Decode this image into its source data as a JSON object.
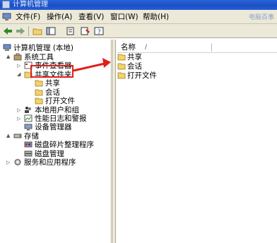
{
  "window": {
    "title": "计算机管理"
  },
  "menu": [
    {
      "label": "文件(F)"
    },
    {
      "label": "操作(A)"
    },
    {
      "label": "查看(V)"
    },
    {
      "label": "窗口(W)"
    },
    {
      "label": "帮助(H)"
    }
  ],
  "logo_text": "电脑百事",
  "toolbar": [
    "back-icon",
    "forward-icon",
    "up-folder-icon",
    "console-tree-icon",
    "export-icon",
    "properties-icon",
    "help-icon"
  ],
  "tree": {
    "root": "计算机管理 (本地)",
    "system_tools": "系统工具",
    "event_viewer": "事件查看器",
    "shared_folders": "共享文件夹",
    "shares": "共享",
    "sessions": "会话",
    "open_files": "打开文件",
    "local_users": "本地用户和组",
    "perf_logs": "性能日志和警报",
    "device_manager": "设备管理器",
    "storage": "存储",
    "defrag": "磁盘碎片整理程序",
    "disk_mgmt": "磁盘管理",
    "services": "服务和应用程序"
  },
  "list": {
    "header": "名称",
    "sort_indicator": "/",
    "items": [
      "共享",
      "会话",
      "打开文件"
    ]
  },
  "colors": {
    "titlebar": "#1b4fc4",
    "chrome": "#ece9d8",
    "highlight": "#e0201b",
    "folder": "#f3d36a"
  }
}
